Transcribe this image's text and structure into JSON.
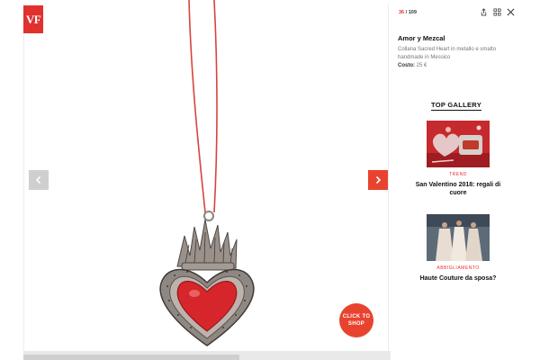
{
  "brand": {
    "logo_text": "VF",
    "accent": "#e1312f"
  },
  "gallery": {
    "counter_current": "36",
    "counter_total": "109",
    "prev_icon": "chevron-left-icon",
    "next_icon": "chevron-right-icon",
    "shop_label_1": "CLICK TO",
    "shop_label_2": "SHOP"
  },
  "toolbar": {
    "share_icon": "share-icon",
    "grid_icon": "grid-icon",
    "close_icon": "close-icon"
  },
  "item": {
    "title": "Amor y Mezcal",
    "description": "Collana Sacred Heart in metallo e smalto handmade in Messico",
    "price_label": "Costo:",
    "price_value": "25 €"
  },
  "top_gallery": {
    "heading": "TOP GALLERY",
    "cards": [
      {
        "category": "TREND",
        "title": "San Valentino 2018: regali di cuore"
      },
      {
        "category": "ABBIGLIAMENTO",
        "title": "Haute Couture da sposa?"
      }
    ]
  }
}
